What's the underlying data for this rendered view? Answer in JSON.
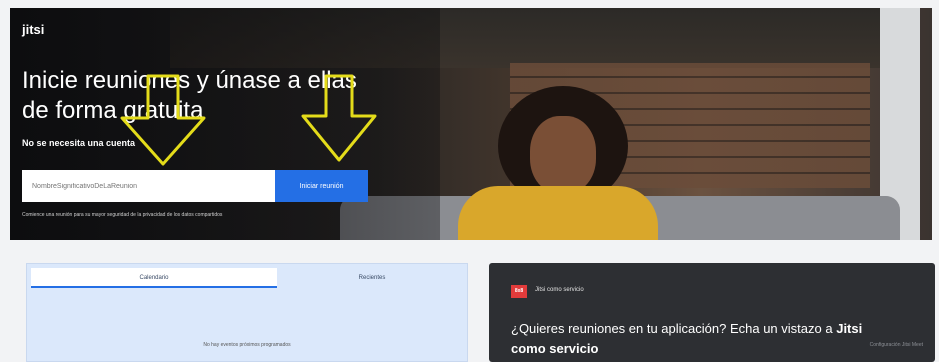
{
  "hero": {
    "logo": "jitsi",
    "title": "Inicie reuniones y únase a ellas de forma gratuita",
    "subtitle": "No se necesita una cuenta",
    "input_placeholder": "NombreSignificativoDeLaReunion",
    "start_button": "Iniciar reunión",
    "note": "Comience una reunión para su mayor seguridad de la privacidad de los datos compartidos"
  },
  "calendar": {
    "tabs": [
      "Calendario",
      "Recientes"
    ],
    "empty_message": "No hay eventos próximos programados"
  },
  "service": {
    "badge": "8x8",
    "label": "Jitsi como servicio",
    "text_prefix": "¿Quieres reuniones en tu aplicación? Echa un vistazo a",
    "text_link": "Jitsi como servicio",
    "faint_note": "Configuración Jitsi Meet"
  },
  "colors": {
    "accent": "#246fe5",
    "arrow": "#e4dc1a",
    "badge": "#e23b3b"
  }
}
